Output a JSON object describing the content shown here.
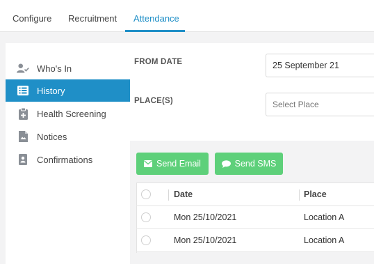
{
  "top_tabs": [
    {
      "label": "Configure"
    },
    {
      "label": "Recruitment"
    },
    {
      "label": "Attendance"
    }
  ],
  "sidebar": {
    "items": [
      {
        "label": "Who's In",
        "icon": "user-check-icon"
      },
      {
        "label": "History",
        "icon": "list-icon"
      },
      {
        "label": "Health Screening",
        "icon": "clipboard-plus-icon"
      },
      {
        "label": "Notices",
        "icon": "document-icon"
      },
      {
        "label": "Confirmations",
        "icon": "id-badge-icon"
      }
    ]
  },
  "form": {
    "from_date_label": "FROM DATE",
    "from_date_value": "25 September 21",
    "places_label": "PLACE(S)",
    "places_placeholder": "Select Place"
  },
  "actions": {
    "send_email_label": "Send Email",
    "send_sms_label": "Send SMS"
  },
  "table": {
    "columns": [
      "Date",
      "Place"
    ],
    "rows": [
      {
        "date": "Mon 25/10/2021",
        "place": "Location A"
      },
      {
        "date": "Mon 25/10/2021",
        "place": "Location A"
      }
    ]
  },
  "colors": {
    "accent": "#1f8fc7",
    "button_green": "#5ed07a",
    "background": "#f3f3f4"
  }
}
